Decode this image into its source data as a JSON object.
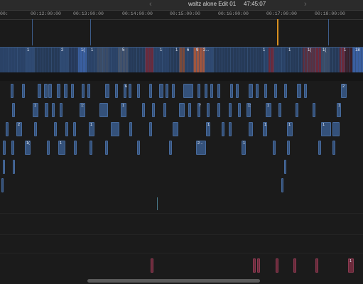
{
  "window": {
    "title": "waltz alone Edit 01",
    "timecode": "47:45:07",
    "nav_prev": "‹",
    "nav_next": "›"
  },
  "ruler": {
    "labels": [
      "00:",
      "00:12:00:00",
      "00:13:00:00",
      "00:14:00:00",
      "00:15:00:00",
      "00:16:00:00",
      "00:17:00:00",
      "00:18:00:00"
    ]
  },
  "primary_storyline": {
    "clip_labels": [
      "1",
      "2",
      "1(",
      "1",
      "5",
      "1",
      "1",
      "6",
      "9",
      "2...",
      "1",
      "1",
      "1(",
      "1(",
      "1",
      "18"
    ]
  },
  "connected_clips": {
    "labels": [
      "6",
      "1",
      "1:",
      "1",
      "1",
      "1",
      "1",
      "7",
      "1:",
      "1",
      "2",
      "1",
      "1",
      "1",
      "1",
      "1",
      "2",
      "1",
      "2...",
      "1",
      "1(",
      "1"
    ]
  },
  "colors": {
    "background": "#1b1b1b",
    "storyline_clip": "#263a57",
    "connected_clip": "#34517a",
    "audio_pink": "#6b2a3b",
    "marker_orange": "#d9901f",
    "marker_blue": "#4a6fa0"
  }
}
